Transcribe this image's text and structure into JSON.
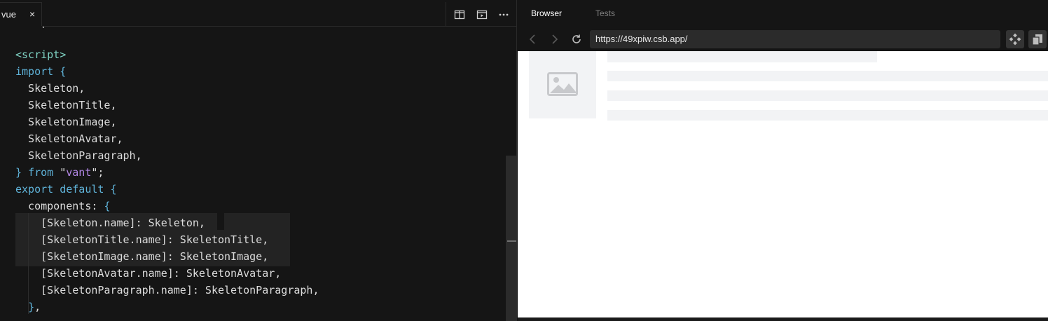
{
  "editor": {
    "tab": {
      "label": "vue",
      "close": "×"
    },
    "actions": [
      "split-editor-icon",
      "preview-icon",
      "more-icon"
    ],
    "code_lines": [
      [
        {
          "c": "t",
          "v": "<script>"
        }
      ],
      [
        {
          "c": "k",
          "v": "import"
        },
        {
          "c": "p",
          "v": " "
        },
        {
          "c": "k",
          "v": "{"
        }
      ],
      [
        {
          "c": "p",
          "v": "  Skeleton,"
        }
      ],
      [
        {
          "c": "p",
          "v": "  SkeletonTitle,"
        }
      ],
      [
        {
          "c": "p",
          "v": "  SkeletonImage,"
        }
      ],
      [
        {
          "c": "p",
          "v": "  SkeletonAvatar,"
        }
      ],
      [
        {
          "c": "p",
          "v": "  SkeletonParagraph,"
        }
      ],
      [
        {
          "c": "k",
          "v": "}"
        },
        {
          "c": "p",
          "v": " "
        },
        {
          "c": "k",
          "v": "from"
        },
        {
          "c": "p",
          "v": " \""
        },
        {
          "c": "s",
          "v": "vant"
        },
        {
          "c": "p",
          "v": "\";"
        }
      ],
      [
        {
          "c": "k",
          "v": "export"
        },
        {
          "c": "p",
          "v": " "
        },
        {
          "c": "k",
          "v": "default"
        },
        {
          "c": "p",
          "v": " "
        },
        {
          "c": "k",
          "v": "{"
        }
      ],
      [
        {
          "c": "p",
          "v": "  components: "
        },
        {
          "c": "k",
          "v": "{"
        }
      ],
      [
        {
          "c": "p",
          "v": "    [Skeleton.name]: Skeleton,"
        }
      ],
      [
        {
          "c": "p",
          "v": "    [SkeletonTitle.name]: SkeletonTitle,"
        }
      ],
      [
        {
          "c": "p",
          "v": "    [SkeletonImage.name]: SkeletonImage,"
        }
      ],
      [
        {
          "c": "p",
          "v": "    [SkeletonAvatar.name]: SkeletonAvatar,"
        }
      ],
      [
        {
          "c": "p",
          "v": "    [SkeletonParagraph.name]: SkeletonParagraph,"
        }
      ],
      [
        {
          "c": "p",
          "v": "  "
        },
        {
          "c": "k",
          "v": "}"
        },
        {
          "c": "p",
          "v": ","
        }
      ]
    ]
  },
  "browser": {
    "tabs": [
      {
        "label": "Browser",
        "active": true
      },
      {
        "label": "Tests",
        "active": false
      }
    ],
    "nav": [
      "back-icon",
      "forward-icon",
      "refresh-icon"
    ],
    "url": "https://49xpiw.csb.app/",
    "utils": [
      "codesandbox-icon",
      "open-new-window-icon"
    ]
  },
  "colors": {
    "bg": "#151515",
    "keyword": "#5fb3d9",
    "tag": "#7fd3c4",
    "string": "#b287e5",
    "text": "#dcdcdc",
    "skeleton": "#f2f3f5"
  }
}
